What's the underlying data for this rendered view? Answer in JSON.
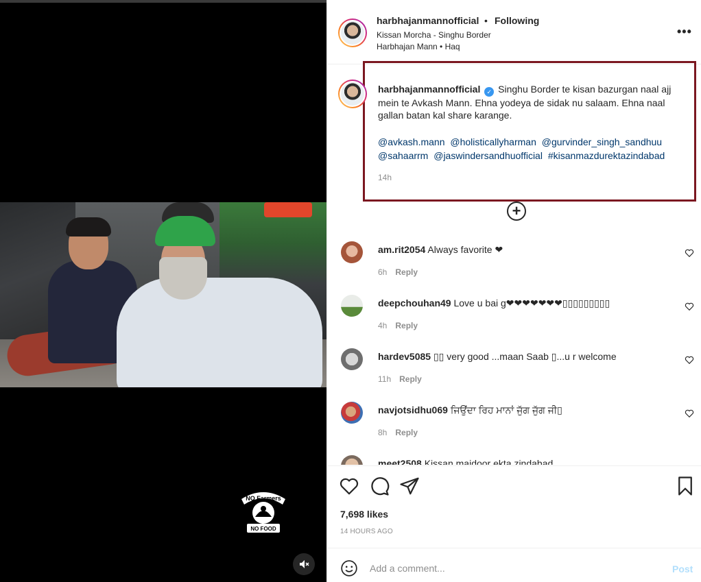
{
  "post": {
    "username": "harbhajanmannofficial",
    "follow_dot": "•",
    "follow_status": "Following",
    "location": "Kissan Morcha - Singhu Border",
    "audio": "Harbhajan Mann • Haq",
    "more_icon": "•••"
  },
  "caption": {
    "username": "harbhajanmannofficial",
    "verified_glyph": "✓",
    "text": "Singhu Border te kisan bazurgan naal ajj mein te Avkash Mann. Ehna yodeya de sidak nu salaam. Ehna naal gallan batan kal share karange.",
    "tags": [
      "@avkash.mann",
      "@holisticallyharman",
      "@gurvinder_singh_sandhuu",
      "@sahaarrm",
      "@jaswindersandhuofficial",
      "#kisanmazdurektazindabad"
    ],
    "time": "14h",
    "load_more_glyph": "+"
  },
  "comments": [
    {
      "username": "am.rit2054",
      "text": "Always favorite ❤",
      "time": "6h",
      "reply": "Reply"
    },
    {
      "username": "deepchouhan49",
      "text": "Love u bai g❤❤❤❤❤❤❤▯▯▯▯▯▯▯▯▯",
      "time": "4h",
      "reply": "Reply"
    },
    {
      "username": "hardev5085",
      "text": "▯▯ very good ...maan Saab ▯...u r welcome",
      "time": "11h",
      "reply": "Reply"
    },
    {
      "username": "navjotsidhu069",
      "text": "ਜਿਉਂਦਾ ਰਿਹ ਮਾਨਾਂ ਜੁੱਗ ਜੁੱਗ ਜੀ▯",
      "time": "8h",
      "reply": "Reply"
    },
    {
      "username": "meet2508",
      "text": "Kissan majdoor ekta zindabad",
      "time": "",
      "reply": ""
    }
  ],
  "stats": {
    "likes": "7,698 likes",
    "posted": "14 HOURS AGO"
  },
  "add_comment": {
    "placeholder": "Add a comment...",
    "post_label": "Post"
  },
  "overlay_logo": {
    "top_text": "NO Farmers",
    "bottom_text": "NO FOOD"
  },
  "icons": {
    "more": "more-options-icon",
    "like": "heart-icon",
    "comment": "comment-bubble-icon",
    "share": "paper-plane-icon",
    "save": "bookmark-icon",
    "emoji": "smiley-icon",
    "mute": "speaker-muted-icon",
    "load_more": "plus-circle-icon"
  },
  "colors": {
    "highlight_box": "#7b1720",
    "link": "#00376b",
    "verified": "#3897f0",
    "post_disabled": "#b2dffc",
    "media_bg": "#000000"
  }
}
